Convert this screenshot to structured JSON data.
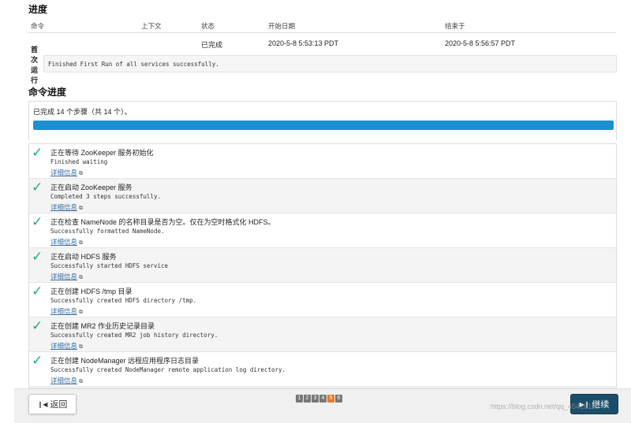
{
  "progress_section": {
    "heading": "进度",
    "columns": {
      "command": "命令",
      "context": "上下文",
      "status": "状态",
      "start_date": "开始日期",
      "end_date": "结束于"
    },
    "row": {
      "command": "首次运行",
      "context": "",
      "status": "已完成",
      "start_date": "2020-5-8 5:53:13 PDT",
      "end_date": "2020-5-8 5:56:57 PDT"
    },
    "result_message": "Finished First Run of all services successfully."
  },
  "command_progress": {
    "heading": "命令进度",
    "summary": "已完成 14 个步骤（共 14 个）。",
    "progress_fraction": 1.0,
    "details_link_label": "详细信息",
    "steps": [
      {
        "title": "正在等待 ZooKeeper 服务初始化",
        "message": "Finished waiting"
      },
      {
        "title": "正在启动 ZooKeeper 服务",
        "message": "Completed 3 steps successfully."
      },
      {
        "title": "正在检查 NameNode 的名称目录是否为空。仅在为空时格式化 HDFS。",
        "message": "Successfully formatted NameNode."
      },
      {
        "title": "正在启动 HDFS 服务",
        "message": "Successfully started HDFS service"
      },
      {
        "title": "正在创建 HDFS /tmp 目录",
        "message": "Successfully created HDFS directory /tmp."
      },
      {
        "title": "正在创建 MR2 作业历史记录目录",
        "message": "Successfully created MR2 job history directory."
      },
      {
        "title": "正在创建 NodeManager 远程应用程序日志目录",
        "message": "Successfully created NodeManager remote application log directory."
      }
    ]
  },
  "footer": {
    "back_label": "返回",
    "next_label": "继续",
    "pages": [
      "1",
      "2",
      "3",
      "4",
      "5",
      "6"
    ],
    "active_page": "5",
    "watermark": "https://blog.csdn.net/qq_45416110"
  },
  "colors": {
    "check": "#2aa88a",
    "progress_fill": "#1d8fd1",
    "link": "#3a6ea5",
    "next_button": "#1c4e6b",
    "active_page": "#e8782a"
  },
  "icons": {
    "check": "check-icon",
    "external_link": "external-link-icon",
    "back": "back-arrow-icon",
    "next": "next-arrow-icon"
  }
}
